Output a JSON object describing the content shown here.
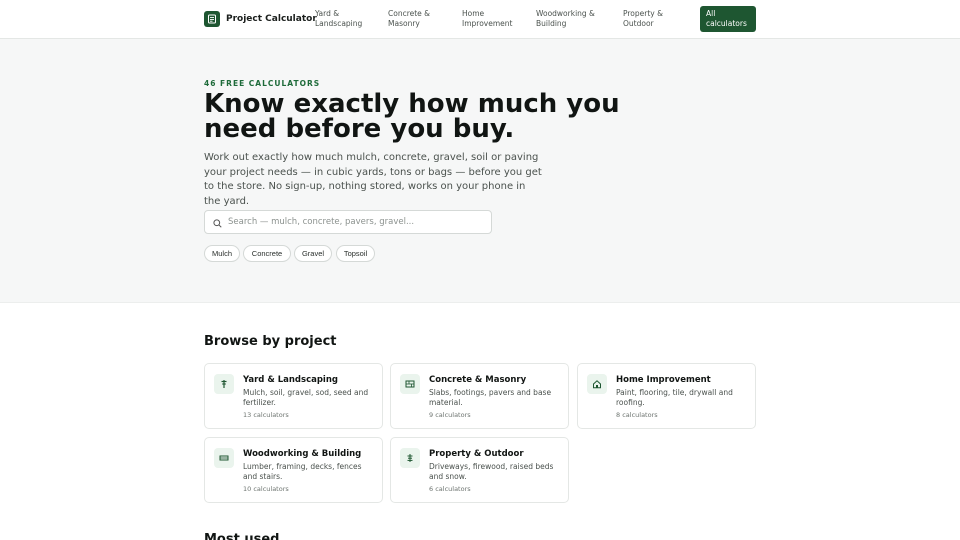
{
  "header": {
    "brand": "Project Calculator",
    "nav": [
      {
        "label": "Yard & Landscaping"
      },
      {
        "label": "Concrete & Masonry"
      },
      {
        "label": "Home Improvement"
      },
      {
        "label": "Woodworking & Building"
      },
      {
        "label": "Property & Outdoor"
      }
    ],
    "cta_label": "All calculators"
  },
  "hero": {
    "eyebrow": "46 FREE CALCULATORS",
    "headline": "Know exactly how much you need before you buy.",
    "subtitle": "Work out exactly how much mulch, concrete, gravel, soil or paving your project needs — in cubic yards, tons or bags — before you get to the store. No sign-up, nothing stored, works on your phone in the yard.",
    "search_placeholder": "Search — mulch, concrete, pavers, gravel...",
    "chips": [
      "Mulch",
      "Concrete",
      "Gravel",
      "Topsoil"
    ]
  },
  "browse": {
    "title": "Browse by project",
    "cards": [
      {
        "title": "Yard & Landscaping",
        "description": "Mulch, soil, gravel, sod, seed and fertilizer.",
        "count": "13 calculators",
        "icon": "shovel-icon"
      },
      {
        "title": "Concrete & Masonry",
        "description": "Slabs, footings, pavers and base material.",
        "count": "9 calculators",
        "icon": "bricks-icon"
      },
      {
        "title": "Home Improvement",
        "description": "Paint, flooring, tile, drywall and roofing.",
        "count": "8 calculators",
        "icon": "house-icon"
      },
      {
        "title": "Woodworking & Building",
        "description": "Lumber, framing, decks, fences and stairs.",
        "count": "10 calculators",
        "icon": "lumber-icon"
      },
      {
        "title": "Property & Outdoor",
        "description": "Driveways, firewood, raised beds and snow.",
        "count": "6 calculators",
        "icon": "tree-icon"
      }
    ]
  },
  "next_section": {
    "title": "Most used"
  },
  "colors": {
    "accent": "#1e5631",
    "accent_light": "#eaf4ed",
    "hero_bg": "#f6f7f7"
  }
}
